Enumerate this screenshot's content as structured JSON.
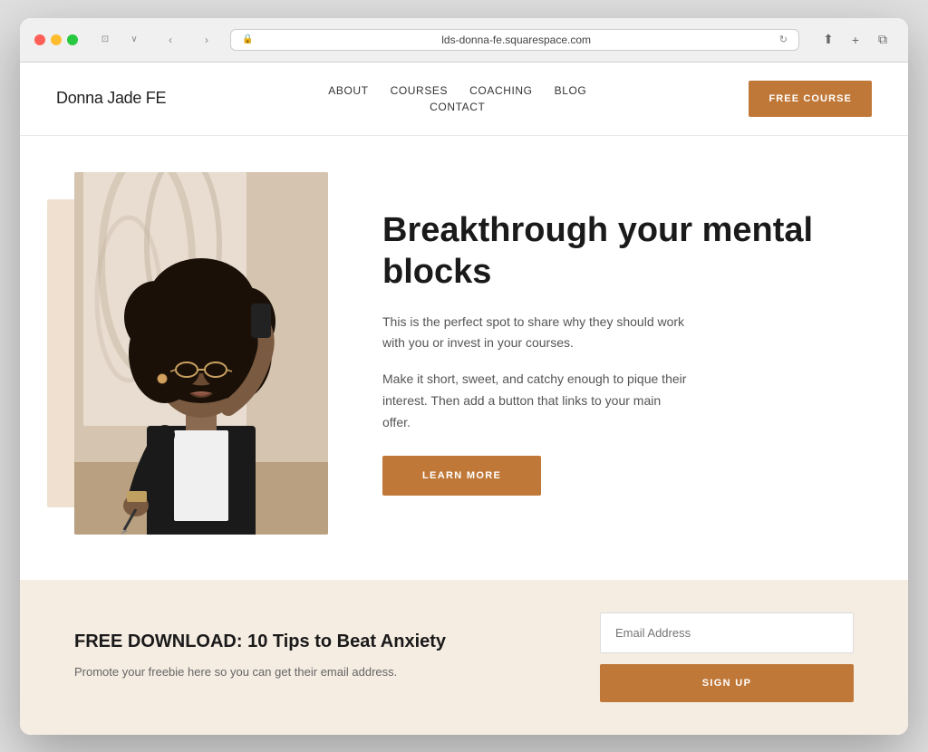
{
  "browser": {
    "url": "lds-donna-fe.squarespace.com",
    "refresh_icon": "↻"
  },
  "header": {
    "logo": "Donna Jade FE",
    "nav": {
      "items": [
        {
          "label": "ABOUT",
          "row": 1
        },
        {
          "label": "COURSES",
          "row": 1
        },
        {
          "label": "COACHING",
          "row": 1
        },
        {
          "label": "BLOG",
          "row": 1
        },
        {
          "label": "CONTACT",
          "row": 2
        }
      ]
    },
    "cta_button": "FREE COURSE"
  },
  "hero": {
    "title": "Breakthrough your mental blocks",
    "description1": "This is the perfect spot to share why they should work with you or invest in your courses.",
    "description2": "Make it short, sweet, and catchy enough to pique their interest. Then add a button that links to your main offer.",
    "learn_more_button": "LEARN MORE"
  },
  "download": {
    "title": "FREE DOWNLOAD: 10 Tips to Beat Anxiety",
    "description": "Promote your freebie here so you can get their email address.",
    "email_placeholder": "Email Address",
    "signup_button": "SIGN UP"
  }
}
